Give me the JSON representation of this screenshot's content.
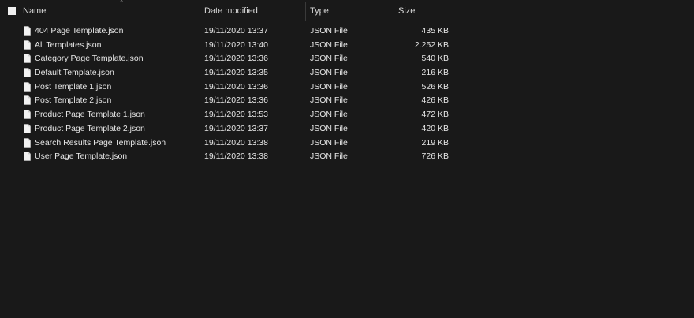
{
  "columns": {
    "name": "Name",
    "date": "Date modified",
    "type": "Type",
    "size": "Size"
  },
  "sort_indicator": "^",
  "files": [
    {
      "name": "404 Page Template.json",
      "date": "19/11/2020 13:37",
      "type": "JSON File",
      "size": "435 KB"
    },
    {
      "name": "All Templates.json",
      "date": "19/11/2020 13:40",
      "type": "JSON File",
      "size": "2.252 KB"
    },
    {
      "name": "Category Page Template.json",
      "date": "19/11/2020 13:36",
      "type": "JSON File",
      "size": "540 KB"
    },
    {
      "name": "Default Template.json",
      "date": "19/11/2020 13:35",
      "type": "JSON File",
      "size": "216 KB"
    },
    {
      "name": "Post Template 1.json",
      "date": "19/11/2020 13:36",
      "type": "JSON File",
      "size": "526 KB"
    },
    {
      "name": "Post Template 2.json",
      "date": "19/11/2020 13:36",
      "type": "JSON File",
      "size": "426 KB"
    },
    {
      "name": "Product Page Template 1.json",
      "date": "19/11/2020 13:53",
      "type": "JSON File",
      "size": "472 KB"
    },
    {
      "name": "Product Page Template 2.json",
      "date": "19/11/2020 13:37",
      "type": "JSON File",
      "size": "420 KB"
    },
    {
      "name": "Search Results Page Template.json",
      "date": "19/11/2020 13:38",
      "type": "JSON File",
      "size": "219 KB"
    },
    {
      "name": "User Page Template.json",
      "date": "19/11/2020 13:38",
      "type": "JSON File",
      "size": "726 KB"
    }
  ]
}
